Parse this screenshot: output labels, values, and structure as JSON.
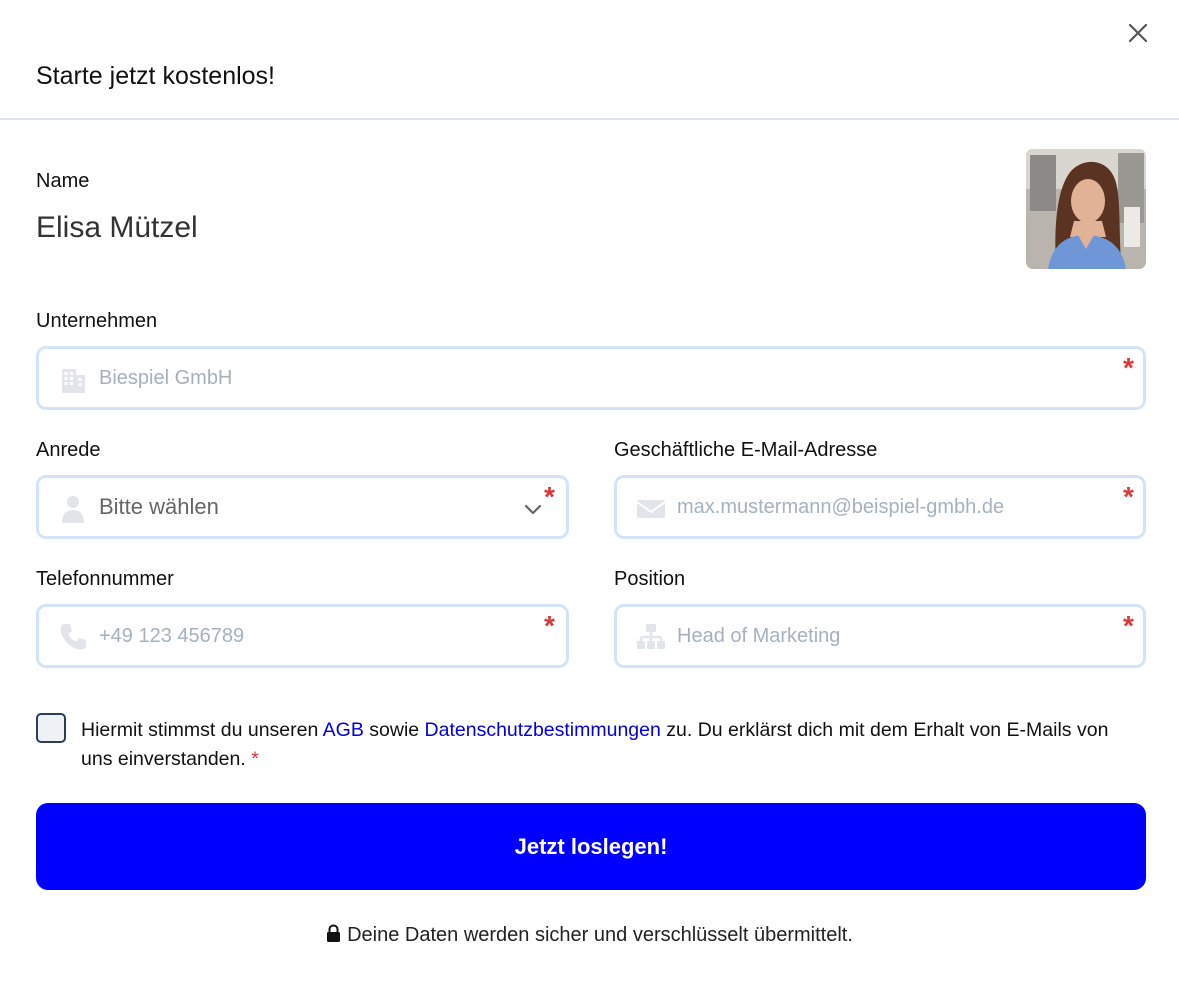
{
  "header": {
    "title": "Starte jetzt kostenlos!",
    "close_icon": "close-icon"
  },
  "name": {
    "label": "Name",
    "value": "Elisa Mützel"
  },
  "company": {
    "label": "Unternehmen",
    "placeholder": "Biespiel GmbH",
    "required": "*",
    "icon": "building-icon"
  },
  "salutation": {
    "label": "Anrede",
    "value": "Bitte wählen",
    "required": "*",
    "icon": "person-icon"
  },
  "email": {
    "label": "Geschäftliche E-Mail-Adresse",
    "placeholder": "max.mustermann@beispiel-gmbh.de",
    "required": "*",
    "icon": "envelope-icon"
  },
  "phone": {
    "label": "Telefonnummer",
    "placeholder": "+49 123 456789",
    "required": "*",
    "icon": "phone-icon"
  },
  "position": {
    "label": "Position",
    "placeholder": "Head of Marketing",
    "required": "*",
    "icon": "org-chart-icon"
  },
  "consent": {
    "text_1": "Hiermit stimmst du unseren ",
    "agb_link": "AGB",
    "text_2": " sowie ",
    "privacy_link": "Datenschutzbestimmungen",
    "text_3": " zu. Du erklärst dich mit dem Erhalt von E-Mails von uns einverstanden. ",
    "required": "*"
  },
  "submit": {
    "label": "Jetzt loslegen!"
  },
  "footer": {
    "secure_text": "Deine Daten werden sicher und verschlüsselt übermittelt.",
    "icon": "lock-icon"
  },
  "colors": {
    "accent": "#0000ff",
    "link": "#0000dd",
    "required": "#d9383d",
    "field_border": "#d4e4f8"
  }
}
